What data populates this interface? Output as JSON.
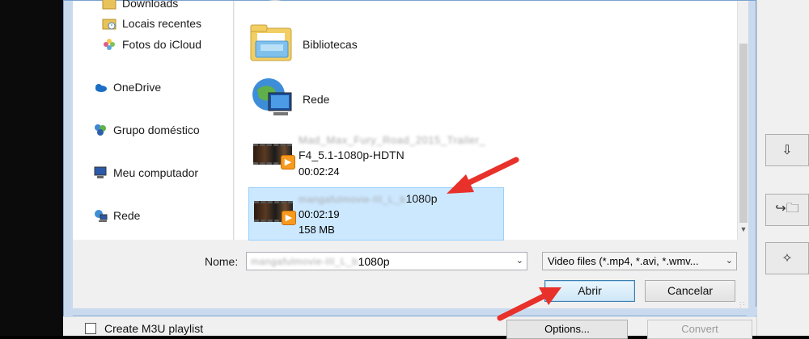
{
  "nav": {
    "items": [
      {
        "label": "Downloads",
        "icon": "folder-icon"
      },
      {
        "label": "Locais recentes",
        "icon": "recent-places-icon"
      },
      {
        "label": "Fotos do iCloud",
        "icon": "icloud-photos-icon"
      },
      {
        "label": "OneDrive",
        "icon": "onedrive-cloud-icon"
      },
      {
        "label": "Grupo doméstico",
        "icon": "homegroup-icon"
      },
      {
        "label": "Meu computador",
        "icon": "computer-icon"
      },
      {
        "label": "Rede",
        "icon": "network-icon"
      }
    ]
  },
  "files": {
    "folders": [
      {
        "name": "Bibliotecas",
        "icon": "libraries-folder-icon"
      },
      {
        "name": "Rede",
        "icon": "network-globe-icon"
      }
    ],
    "videos": [
      {
        "name_line1": "Mad_Max_Fury_Road_2015_Trailer_",
        "name_line2": "F4_5.1-1080p-HDTN",
        "duration": "00:02:24",
        "selected": false
      },
      {
        "name": "mangafulmovie-III_L_b1080p",
        "name_visible_suffix": "1080p",
        "duration": "00:02:19",
        "size": "158 MB",
        "selected": true
      }
    ]
  },
  "form": {
    "name_label": "Nome:",
    "name_value_blurred": "mangafulmovie-III_L_b",
    "name_value_suffix": "1080p",
    "file_type": "Video files (*.mp4, *.avi, *.wmv..."
  },
  "buttons": {
    "open": "Abrir",
    "cancel": "Cancelar"
  },
  "background_app": {
    "playlist_label": "Create M3U playlist",
    "options_label": "Options...",
    "convert_label": "Convert"
  },
  "colors": {
    "arrow": "#e8312a",
    "selection": "#cce8ff",
    "accent_border": "#3c7fb1"
  }
}
